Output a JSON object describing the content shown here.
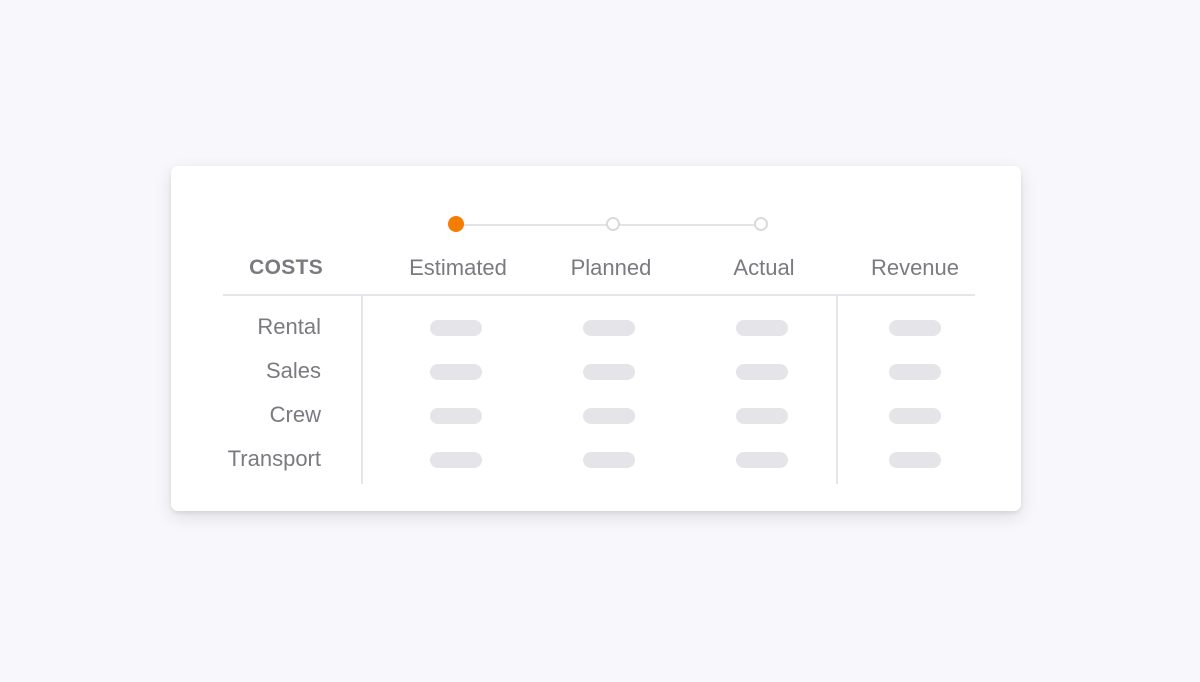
{
  "stepper": {
    "steps": [
      "Estimated",
      "Planned",
      "Actual"
    ],
    "active_index": 0,
    "accent_color": "#f57c00"
  },
  "table": {
    "row_header": "COSTS",
    "columns": [
      "Estimated",
      "Planned",
      "Actual",
      "Revenue"
    ],
    "rows": [
      "Rental",
      "Sales",
      "Crew",
      "Transport"
    ],
    "cell_state": "placeholder"
  }
}
